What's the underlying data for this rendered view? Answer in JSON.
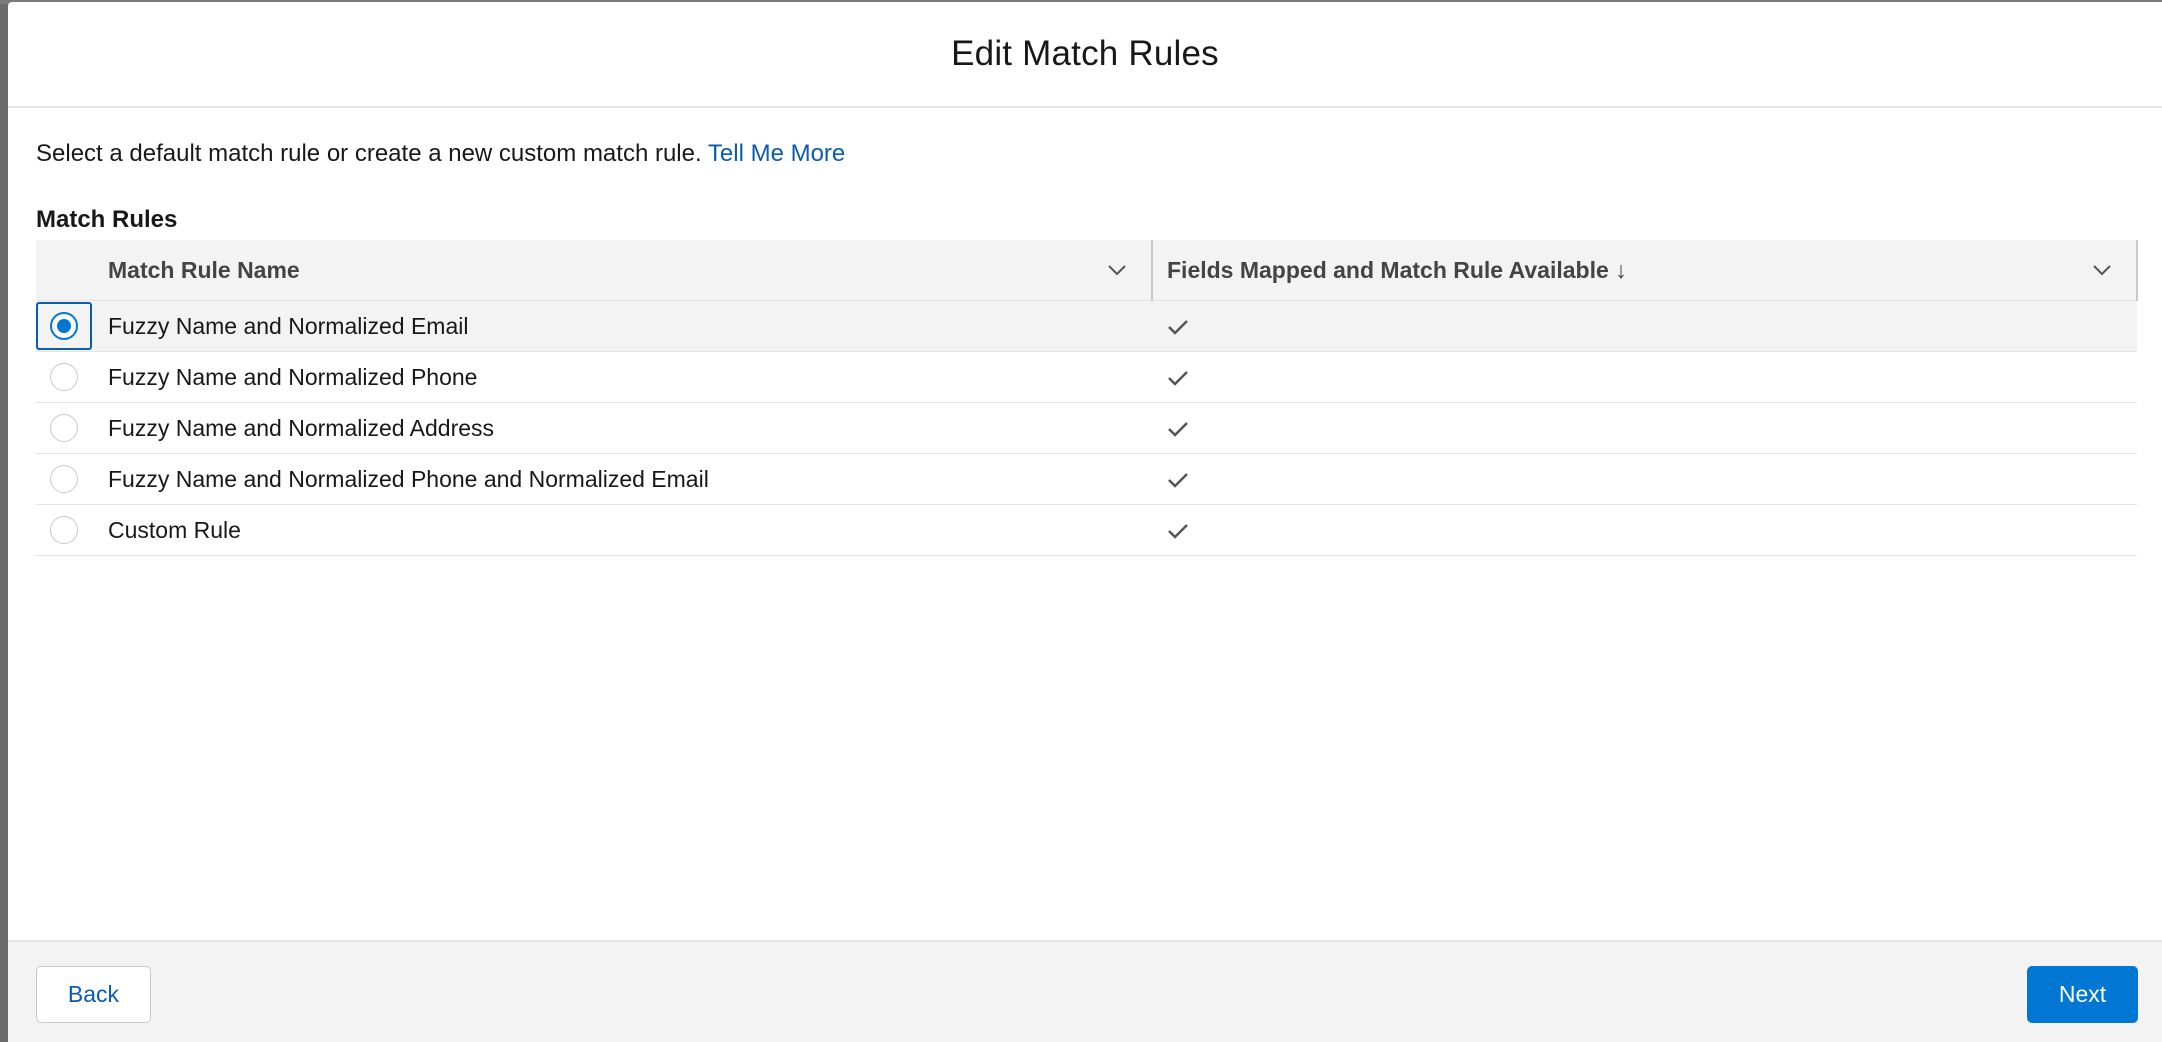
{
  "modal": {
    "title": "Edit Match Rules",
    "intro_text": "Select a default match rule or create a new custom match rule.",
    "intro_link": "Tell Me More",
    "section_title": "Match Rules"
  },
  "table": {
    "columns": [
      {
        "label": "Match Rule Name",
        "icon": "chevron-down-icon"
      },
      {
        "label": "Fields Mapped and Match Rule Available ↓",
        "icon": "chevron-down-icon"
      }
    ],
    "rows": [
      {
        "name": "Fuzzy Name and Normalized Email",
        "available": true,
        "selected": true
      },
      {
        "name": "Fuzzy Name and Normalized Phone",
        "available": true,
        "selected": false
      },
      {
        "name": "Fuzzy Name and Normalized Address",
        "available": true,
        "selected": false
      },
      {
        "name": "Fuzzy Name and Normalized Phone and Normalized Email",
        "available": true,
        "selected": false
      },
      {
        "name": "Custom Rule",
        "available": true,
        "selected": false
      }
    ]
  },
  "footer": {
    "back_label": "Back",
    "next_label": "Next"
  },
  "colors": {
    "brand": "#0176d3",
    "link": "#0b5cab",
    "header_bg": "#f3f3f3"
  }
}
